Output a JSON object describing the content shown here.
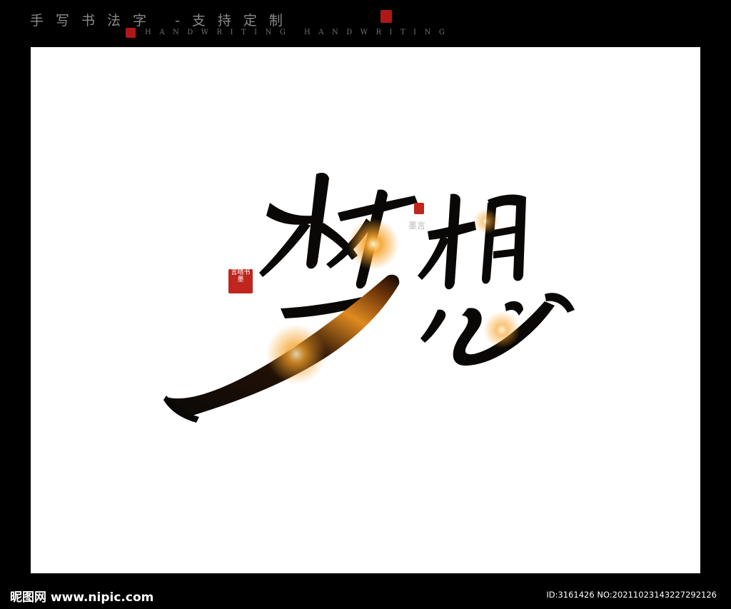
{
  "header": {
    "title": "手写书法字 -支持定制",
    "subtitle": "HANDWRITING HANDWRITING"
  },
  "artwork": {
    "calligraphy_text": "梦想",
    "seal_text": "言晴书墨",
    "signature": "墨言"
  },
  "footer": {
    "logo": "昵图网 www.nipic.com",
    "image_id": "ID:3161426 NO:20211023143227292126"
  },
  "colors": {
    "background": "#000000",
    "canvas": "#ffffff",
    "ink": "#0a0806",
    "glow": "#f6a228",
    "seal": "#c0261e"
  }
}
